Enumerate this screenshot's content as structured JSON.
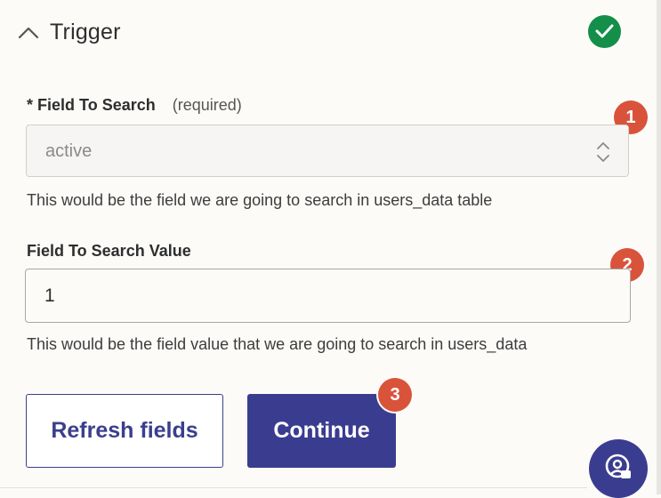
{
  "header": {
    "title": "Trigger",
    "status_icon": "check-circle-icon",
    "collapse_icon": "chevron-up-icon"
  },
  "field_search": {
    "asterisk": "*",
    "label": "Field To Search",
    "required_text": "(required)",
    "value": "active",
    "help": "This would be the field we are going to search in users_data table"
  },
  "field_value": {
    "label": "Field To Search Value",
    "value": "1",
    "help": "This would be the field value that we are going to search in users_data"
  },
  "buttons": {
    "refresh_label": "Refresh fields",
    "continue_label": "Continue"
  },
  "badges": [
    "1",
    "2",
    "3"
  ],
  "colors": {
    "primary": "#3a3d8f",
    "success": "#138f4a",
    "badge": "#d9533b",
    "background": "#fdfbf8"
  }
}
